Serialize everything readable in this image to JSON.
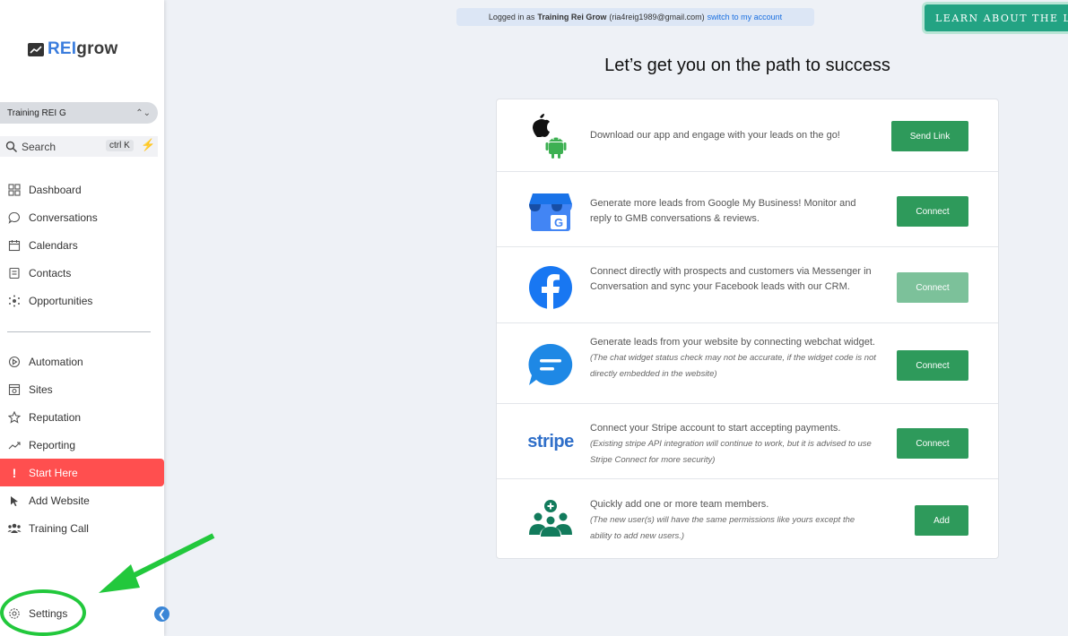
{
  "sidebar": {
    "logo_rei": "REI",
    "logo_grow": "grow",
    "account_name": "Training REI G",
    "search_placeholder": "Search",
    "search_shortcut": "ctrl K",
    "items": [
      {
        "label": "Dashboard",
        "icon": "dashboard-icon"
      },
      {
        "label": "Conversations",
        "icon": "chat-bubble-icon"
      },
      {
        "label": "Calendars",
        "icon": "calendar-icon"
      },
      {
        "label": "Contacts",
        "icon": "contacts-icon"
      },
      {
        "label": "Opportunities",
        "icon": "opportunities-icon"
      },
      {
        "label": "Automation",
        "icon": "automation-icon"
      },
      {
        "label": "Sites",
        "icon": "sites-icon"
      },
      {
        "label": "Reputation",
        "icon": "star-icon"
      },
      {
        "label": "Reporting",
        "icon": "trend-icon"
      },
      {
        "label": "Start Here",
        "icon": "exclamation-icon"
      },
      {
        "label": "Add Website",
        "icon": "pointer-icon"
      },
      {
        "label": "Training Call",
        "icon": "users-icon"
      }
    ],
    "settings_label": "Settings",
    "active_color": "#ff4f4f"
  },
  "header": {
    "login_prefix": "Logged in as",
    "login_name": "Training Rei Grow",
    "login_email": "(ria4reig1989@gmail.com)",
    "switch_link": "switch to my account",
    "learn_button": "LEARN ABOUT THE LA"
  },
  "main": {
    "headline": "Let’s get you on the path to success",
    "rows": [
      {
        "icon": "app-store-icon",
        "text": "Download our app and engage with your leads on the go!",
        "note": "",
        "button": "Send Link",
        "enabled": true
      },
      {
        "icon": "google-my-business-icon",
        "text": "Generate more leads from Google My Business! Monitor and reply to GMB conversations & reviews.",
        "note": "",
        "button": "Connect",
        "enabled": true
      },
      {
        "icon": "facebook-icon",
        "text": "Connect directly with prospects and customers via Messenger in Conversation and sync your Facebook leads with our CRM.",
        "note": "",
        "button": "Connect",
        "enabled": false
      },
      {
        "icon": "webchat-icon",
        "text": "Generate leads from your website by connecting webchat widget.",
        "note": "(The chat widget status check may not be accurate, if the widget code is not directly embedded in the website)",
        "button": "Connect",
        "enabled": true
      },
      {
        "icon": "stripe-icon",
        "text": "Connect your Stripe account to start accepting payments.",
        "note": "(Existing stripe API integration will continue to work, but it is advised to use Stripe Connect for more security)",
        "button": "Connect",
        "enabled": true
      },
      {
        "icon": "team-members-icon",
        "text": "Quickly add one or more team members.",
        "note": "(The new user(s) will have the same permissions like yours except the ability to add new users.)",
        "button": "Add",
        "enabled": true
      }
    ],
    "stripe_wordmark": "stripe",
    "accent": "#2e9a5b"
  }
}
